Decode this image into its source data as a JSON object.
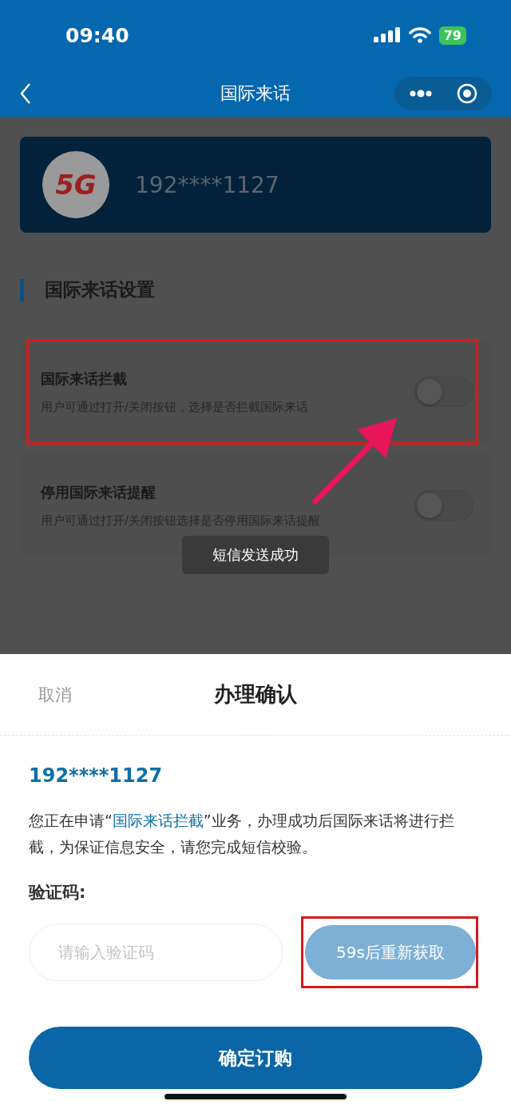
{
  "status_bar": {
    "time": "09:40",
    "battery": "79"
  },
  "nav": {
    "title": "国际来话"
  },
  "account_card": {
    "logo": "5G",
    "phone": "192****1127"
  },
  "section": {
    "title": "国际来话设置"
  },
  "settings": [
    {
      "title": "国际来话拦截",
      "description": "用户可通过打开/关闭按钮，选择是否拦截国际来话",
      "on": false,
      "highlighted": true
    },
    {
      "title": "停用国际来话提醒",
      "description": "用户可通过打开/关闭按钮选择是否停用国际来话提醒",
      "on": false,
      "highlighted": false
    }
  ],
  "toast": "短信发送成功",
  "sheet": {
    "cancel": "取消",
    "title": "办理确认",
    "phone": "192****1127",
    "notice_before": "您正在申请“",
    "notice_link": "国际来话拦截",
    "notice_after": "”业务，办理成功后国际来话将进行拦截，为保证信息安全，请您完成短信校验。",
    "code_label": "验证码:",
    "code_placeholder": "请输入验证码",
    "resend": "59s后重新获取",
    "resend_highlighted": true,
    "confirm": "确定订购"
  }
}
